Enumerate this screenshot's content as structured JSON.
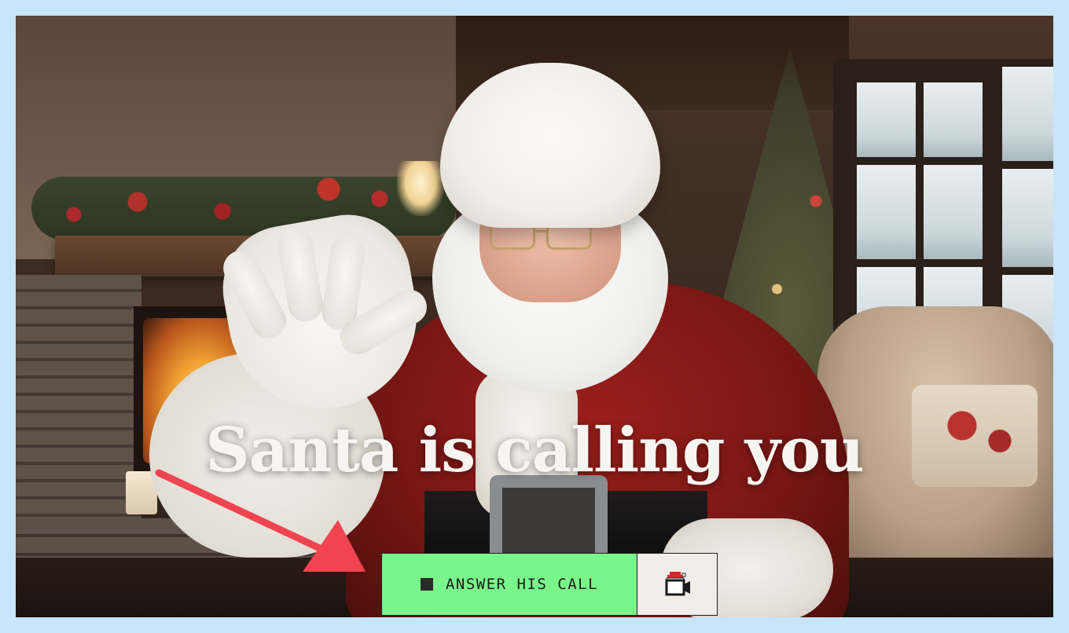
{
  "headline": "Santa is calling you",
  "controls": {
    "answer_label": "ANSWER HIS CALL",
    "answer_icon": "stop-square-icon",
    "video_icon": "video-camera-santa-hat-icon"
  },
  "colors": {
    "page_background": "#c7e6fb",
    "answer_button": "#7af58a",
    "video_button": "#f0ece7",
    "arrow": "#f04550",
    "headline": "#f7f5f1"
  },
  "background_image": {
    "subject": "santa-claus-waving",
    "setting": "cozy-christmas-cabin-with-fireplace-tree-window"
  }
}
